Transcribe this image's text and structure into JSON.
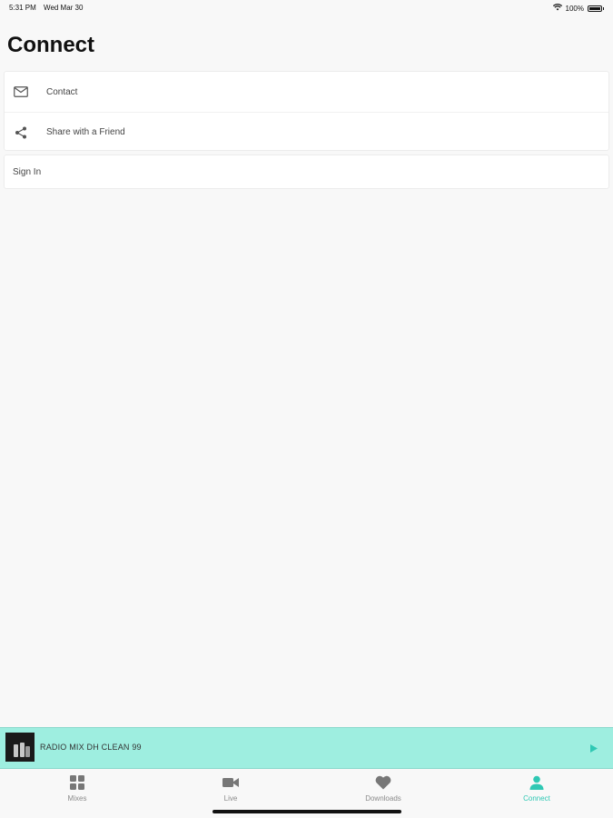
{
  "status_bar": {
    "time": "5:31 PM",
    "date": "Wed Mar 30",
    "battery": "100%",
    "wifi_icon": "wifi-icon",
    "battery_icon": "battery-icon"
  },
  "page": {
    "title": "Connect"
  },
  "menu": {
    "items": [
      {
        "label": "Contact",
        "icon": "envelope-icon"
      },
      {
        "label": "Share with a Friend",
        "icon": "share-icon"
      }
    ],
    "sign_in": {
      "label": "Sign In"
    }
  },
  "player": {
    "track_title": "RADIO MIX DH CLEAN 99",
    "play_icon": "play-icon",
    "background": "#9eeee0",
    "accent": "#2fc8b4"
  },
  "tabs": [
    {
      "label": "Mixes",
      "icon": "grid-icon",
      "active": false
    },
    {
      "label": "Live",
      "icon": "video-camera-icon",
      "active": false
    },
    {
      "label": "Downloads",
      "icon": "heart-icon",
      "active": false
    },
    {
      "label": "Connect",
      "icon": "person-icon",
      "active": true
    }
  ]
}
